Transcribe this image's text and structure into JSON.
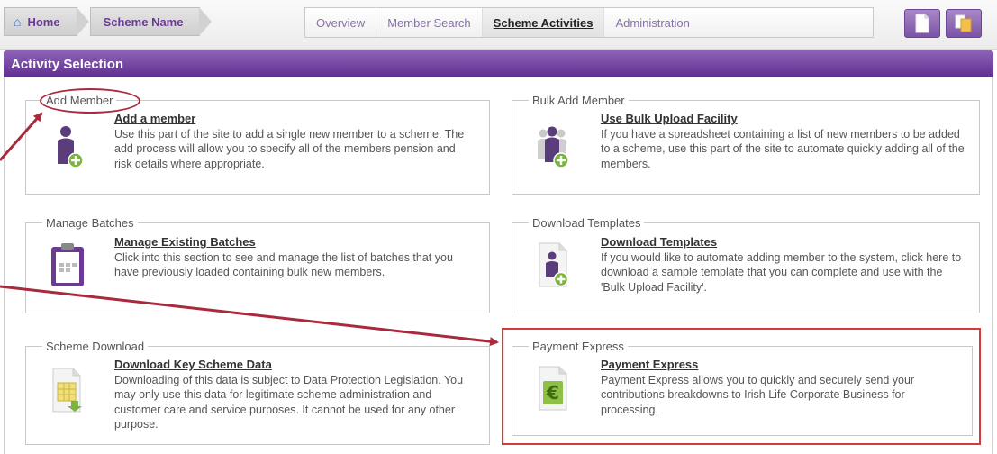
{
  "nav": {
    "breadcrumbs": [
      {
        "label": "Home",
        "icon": "home-icon"
      },
      {
        "label": "Scheme Name"
      }
    ],
    "tabs": [
      {
        "label": "Overview",
        "active": false
      },
      {
        "label": "Member Search",
        "active": false
      },
      {
        "label": "Scheme Activities",
        "active": true
      },
      {
        "label": "Administration",
        "active": false
      }
    ],
    "icon_buttons": [
      {
        "icon": "document-icon"
      },
      {
        "icon": "documents-swap-icon"
      }
    ]
  },
  "section": {
    "title": "Activity Selection"
  },
  "activities": {
    "add_member": {
      "legend": "Add Member",
      "link": "Add a member",
      "description": "Use this part of the site to add a single new member to a scheme. The add process will allow you to specify all of the members pension and risk details where appropriate.",
      "icon": "add-member-icon"
    },
    "bulk_add_member": {
      "legend": "Bulk Add Member",
      "link": "Use Bulk Upload Facility",
      "description": "If you have a spreadsheet containing a list of new members to be added to a scheme, use this part of the site to automate quickly adding all of the members.",
      "icon": "bulk-add-members-icon"
    },
    "manage_batches": {
      "legend": "Manage Batches",
      "link": "Manage Existing Batches",
      "description": "Click into this section to see and manage the list of batches that you have previously loaded containing bulk new members.",
      "icon": "clipboard-icon"
    },
    "download_templates": {
      "legend": "Download Templates",
      "link": "Download Templates",
      "description": "If you would like to automate adding member to the system, click here to download a sample template that you can complete and use with the 'Bulk Upload Facility'.",
      "icon": "template-download-icon"
    },
    "scheme_download": {
      "legend": "Scheme Download",
      "link": "Download Key Scheme Data",
      "description": "Downloading of this data is subject to Data Protection Legislation. You may only use this data for legitimate scheme administration and customer care and service purposes. It cannot be used for any other purpose.",
      "icon": "spreadsheet-download-icon"
    },
    "payment_express": {
      "legend": "Payment Express",
      "link": "Payment Express",
      "description": "Payment Express allows you to quickly and securely send your contributions breakdowns to Irish Life Corporate Business for processing.",
      "icon": "euro-document-icon"
    }
  },
  "colors": {
    "brand_purple": "#6b3a93",
    "annotation_red": "#a82a3c",
    "highlight_red": "#d63a3a"
  }
}
